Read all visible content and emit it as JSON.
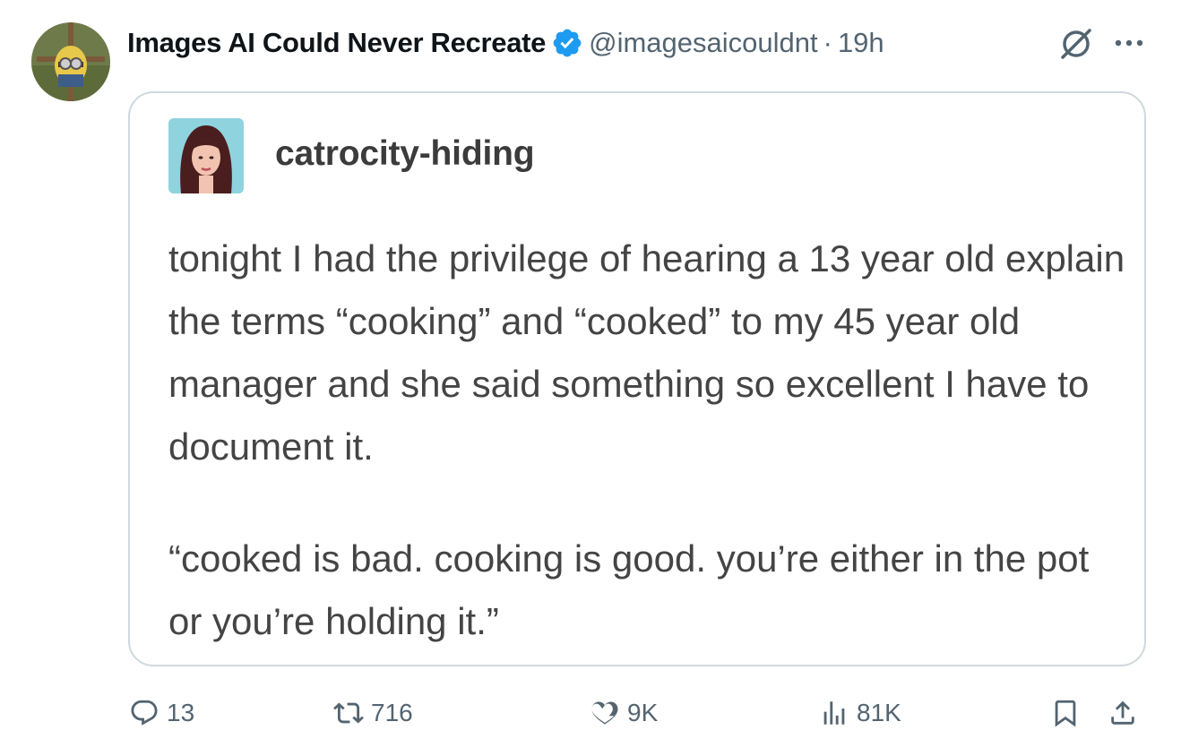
{
  "tweet": {
    "author_name": "Images AI Could Never Recreate",
    "handle": "@imagesaicouldnt",
    "separator": "·",
    "time": "19h",
    "verified_color": "#1d9bf0"
  },
  "embedded_post": {
    "username": "catrocity-hiding",
    "paragraph_1": "tonight I had the privilege of hearing a 13 year old explain the terms “cooking” and “cooked” to my 45 year old manager and she said something so excellent I have to document it.",
    "paragraph_2": "“cooked is bad. cooking is good. you’re either in the pot or you’re holding it.”"
  },
  "actions": {
    "replies": "13",
    "reposts": "716",
    "likes": "9K",
    "views": "81K"
  },
  "icons": {
    "header": [
      "grok-icon",
      "more-icon"
    ],
    "action_bar": [
      "reply-icon",
      "retweet-icon",
      "like-icon",
      "views-icon",
      "bookmark-icon",
      "share-icon"
    ]
  }
}
